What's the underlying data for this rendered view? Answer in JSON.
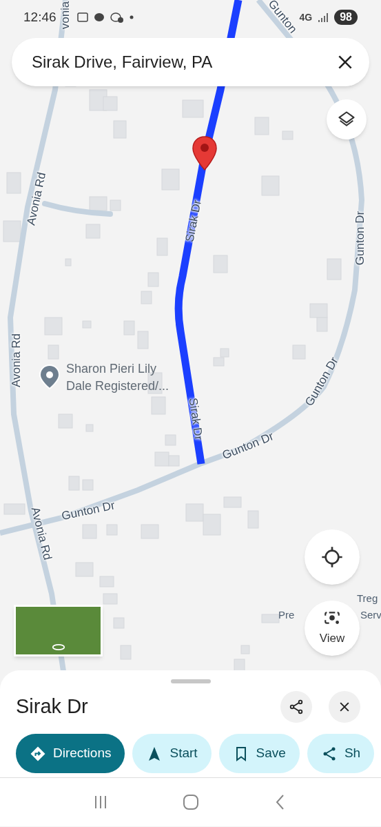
{
  "status_bar": {
    "time": "12:46",
    "network": "4G",
    "battery": "98"
  },
  "search": {
    "value": "Sirak Drive, Fairview, PA"
  },
  "map": {
    "road_labels": [
      "vonia",
      "Gunton",
      "Sirak Dr",
      "Avonia Rd",
      "Gunton Dr",
      "Avonia Rd",
      "Sirak Dr",
      "Gunton Dr",
      "Gunton Dr",
      "Gunton Dr",
      "Avonia Rd"
    ],
    "place": {
      "name": "Sharon Pieri Lily Dale Registered/..."
    },
    "partial_labels": [
      "Treg",
      "Pre",
      "Serv"
    ]
  },
  "view_button": {
    "label": "View"
  },
  "sheet": {
    "title": "Sirak Dr",
    "actions": [
      {
        "label": "Directions",
        "kind": "filled"
      },
      {
        "label": "Start",
        "kind": "tonal"
      },
      {
        "label": "Save",
        "kind": "tonal"
      },
      {
        "label": "Sh",
        "kind": "tonal"
      }
    ]
  }
}
